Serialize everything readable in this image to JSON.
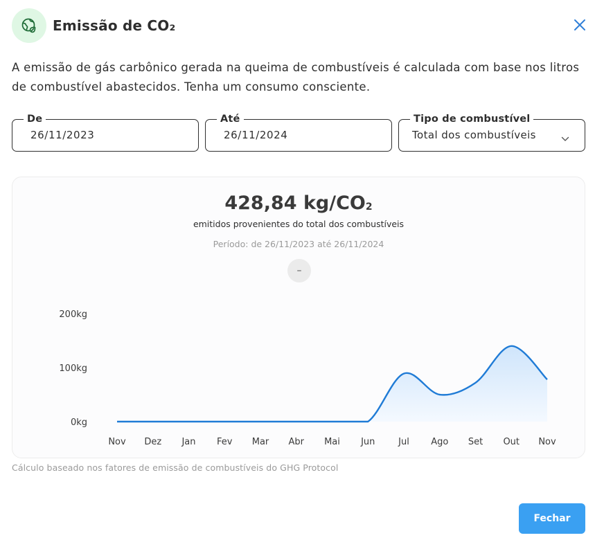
{
  "header": {
    "title": "Emissão de CO₂",
    "icon": "eco-globe-icon"
  },
  "description": "A emissão de gás carbônico gerada na queima de combustíveis é calculada com base nos litros de combustível abastecidos. Tenha um consumo consciente.",
  "filters": {
    "from": {
      "label": "De",
      "value": "26/11/2023"
    },
    "to": {
      "label": "Até",
      "value": "26/11/2024"
    },
    "fuel": {
      "label": "Tipo de combustível",
      "value": "Total dos combustíveis"
    }
  },
  "summary": {
    "total": "428,84 kg/CO",
    "total_sub": "2",
    "caption": "emitidos provenientes do total dos combustíveis",
    "period": "Período: de 26/11/2023 até 26/11/2024",
    "collapse_label": "–"
  },
  "chart_data": {
    "type": "area",
    "categories": [
      "Nov",
      "Dez",
      "Jan",
      "Fev",
      "Mar",
      "Abr",
      "Mai",
      "Jun",
      "Jul",
      "Ago",
      "Set",
      "Out",
      "Nov"
    ],
    "values": [
      0,
      0,
      0,
      0,
      0,
      0,
      0,
      0,
      89,
      50,
      72,
      140,
      78
    ],
    "y_ticks": [
      "0kg",
      "100kg",
      "200kg"
    ],
    "ylim": [
      0,
      200
    ],
    "grid": false,
    "colors": {
      "line": "#1f7bd6",
      "fill_top": "#cfe5fb",
      "fill_bottom": "#f4f9ff"
    }
  },
  "footnote": "Cálculo baseado nos fatores de emissão de combustíveis do GHG Protocol",
  "actions": {
    "close_label": "Fechar"
  },
  "colors": {
    "accent": "#3aa0f2",
    "icon_bg": "#dff7e4",
    "icon_fg": "#2c9a4b"
  }
}
